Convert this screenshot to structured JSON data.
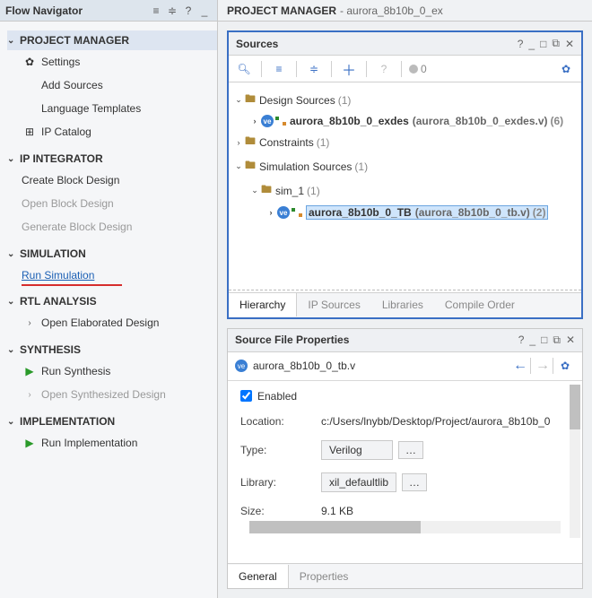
{
  "nav": {
    "title": "Flow Navigator",
    "sections": [
      {
        "label": "PROJECT MANAGER",
        "items": [
          {
            "label": "Settings",
            "icon": "gear"
          },
          {
            "label": "Add Sources"
          },
          {
            "label": "Language Templates"
          },
          {
            "label": "IP Catalog",
            "icon": "ip"
          }
        ],
        "highlight": true
      },
      {
        "label": "IP INTEGRATOR",
        "items": [
          {
            "label": "Create Block Design"
          },
          {
            "label": "Open Block Design",
            "disabled": true
          },
          {
            "label": "Generate Block Design",
            "disabled": true
          }
        ]
      },
      {
        "label": "SIMULATION",
        "items": [
          {
            "label": "Run Simulation",
            "highlight": true
          }
        ]
      },
      {
        "label": "RTL ANALYSIS",
        "items": [
          {
            "label": "Open Elaborated Design",
            "chev": true
          }
        ]
      },
      {
        "label": "SYNTHESIS",
        "items": [
          {
            "label": "Run Synthesis",
            "icon": "play"
          },
          {
            "label": "Open Synthesized Design",
            "chev": true,
            "disabled": true
          }
        ]
      },
      {
        "label": "IMPLEMENTATION",
        "items": [
          {
            "label": "Run Implementation",
            "icon": "play"
          }
        ]
      }
    ]
  },
  "main": {
    "title": "PROJECT MANAGER",
    "subtitle": "aurora_8b10b_0_ex"
  },
  "sources": {
    "title": "Sources",
    "count": "0",
    "tree": {
      "design_sources": {
        "label": "Design Sources",
        "count": "(1)"
      },
      "design_child": {
        "name": "aurora_8b10b_0_exdes",
        "file": "(aurora_8b10b_0_exdes.v)",
        "count": "(6)"
      },
      "constraints": {
        "label": "Constraints",
        "count": "(1)"
      },
      "sim_sources": {
        "label": "Simulation Sources",
        "count": "(1)"
      },
      "sim1": {
        "label": "sim_1",
        "count": "(1)"
      },
      "tb": {
        "name": "aurora_8b10b_0_TB",
        "file": "(aurora_8b10b_0_tb.v)",
        "count": "(2)"
      }
    },
    "tabs": [
      "Hierarchy",
      "IP Sources",
      "Libraries",
      "Compile Order"
    ]
  },
  "props": {
    "title": "Source File Properties",
    "file": "aurora_8b10b_0_tb.v",
    "enabled": "Enabled",
    "rows": {
      "location": {
        "label": "Location:",
        "value": "c:/Users/lnybb/Desktop/Project/aurora_8b10b_0"
      },
      "type": {
        "label": "Type:",
        "value": "Verilog"
      },
      "library": {
        "label": "Library:",
        "value": "xil_defaultlib"
      },
      "size": {
        "label": "Size:",
        "value": "9.1 KB"
      }
    },
    "tabs": [
      "General",
      "Properties"
    ]
  }
}
